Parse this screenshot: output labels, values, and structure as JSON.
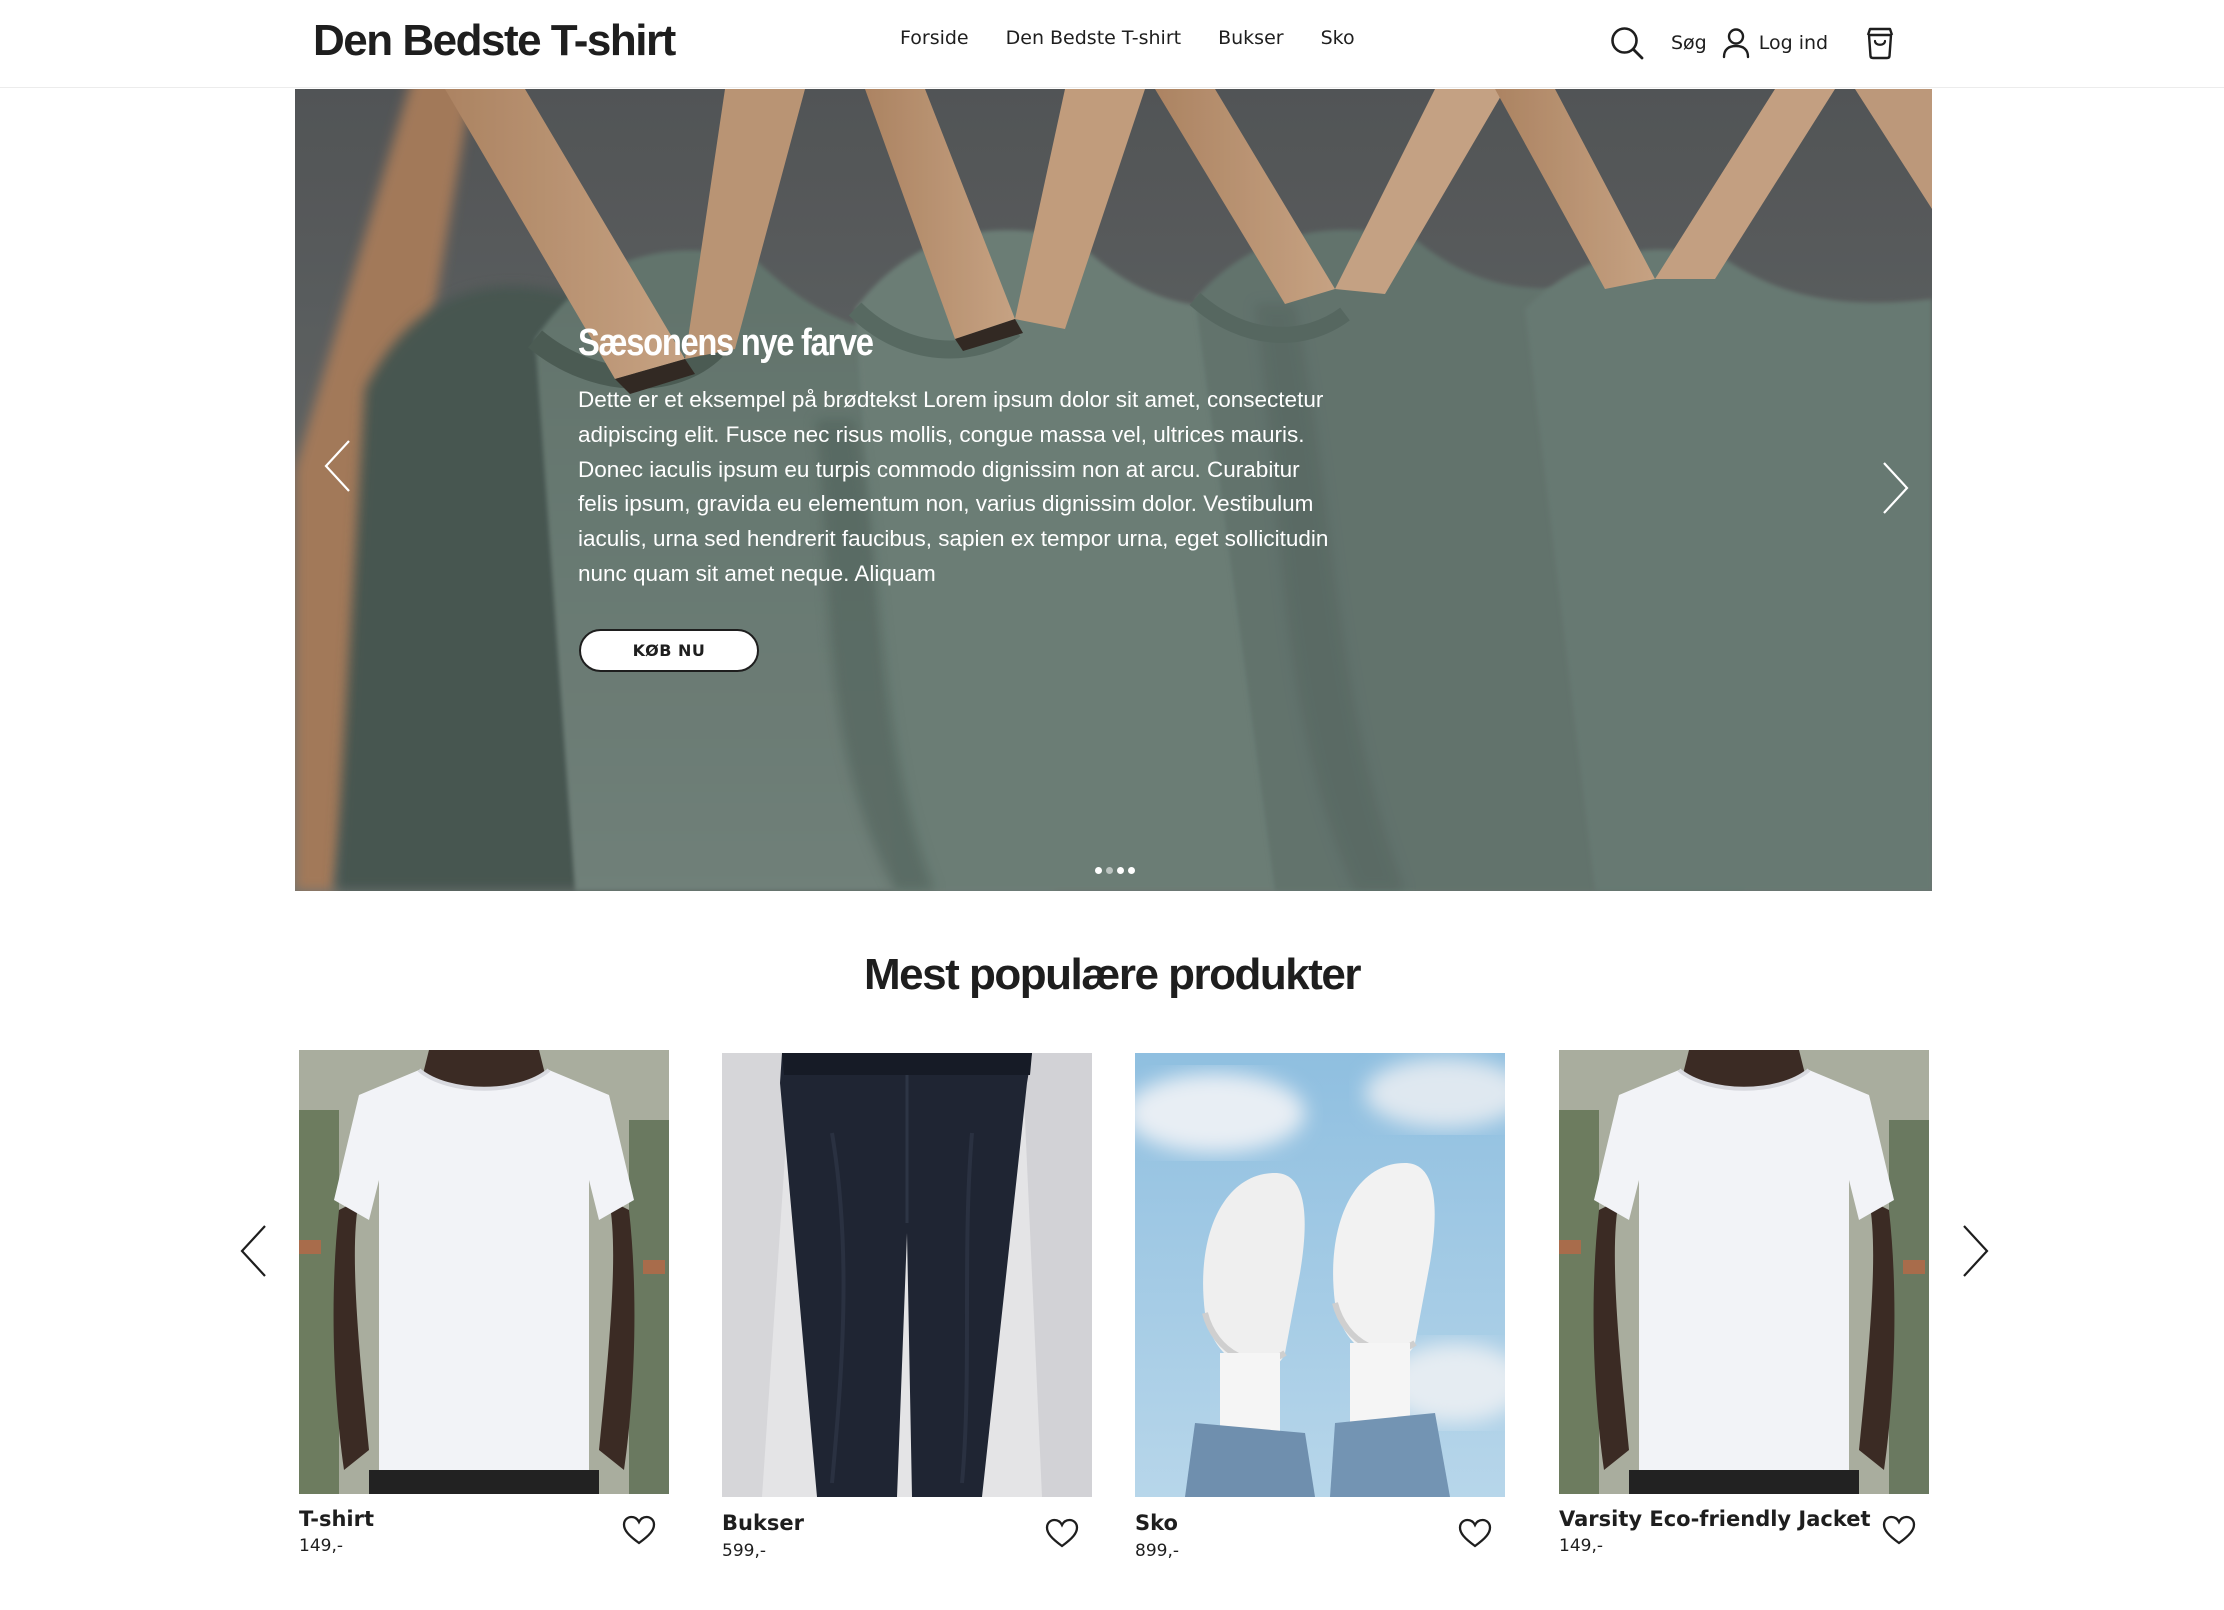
{
  "header": {
    "logo": "Den Bedste T-shirt",
    "nav": [
      "Forside",
      "Den Bedste T-shirt",
      "Bukser",
      "Sko"
    ],
    "search_label": "Søg",
    "login_label": "Log ind",
    "icons": {
      "search": "search-icon",
      "user": "user-icon",
      "cart": "shopping-bag-icon"
    }
  },
  "hero": {
    "title": "Sæsonens nye farve",
    "body": "Dette er et eksempel på brødtekst Lorem ipsum dolor sit amet, consectetur adipiscing elit. Fusce nec risus mollis, congue massa vel, ultrices mauris. Donec iaculis ipsum eu turpis commodo dignissim non at arcu. Curabitur felis ipsum, gravida eu elementum non, varius dignissim dolor. Vestibulum iaculis, urna sed hendrerit faucibus, sapien ex tempor urna, eget sollicitudin nunc quam sit amet neque. Aliquam",
    "cta": "KØB NU",
    "slides_count": 4,
    "active_slide": 1
  },
  "popular": {
    "title": "Mest populære produkter",
    "products": [
      {
        "name": "T-shirt",
        "price": "149,-"
      },
      {
        "name": "Bukser",
        "price": "599,-"
      },
      {
        "name": "Sko",
        "price": "899,-"
      },
      {
        "name": "Varsity Eco-friendly Jacket",
        "price": "149,-"
      }
    ]
  },
  "colors": {
    "text": "#1e1e1e",
    "background": "#ffffff",
    "hero_shirt": "#6f847b"
  }
}
